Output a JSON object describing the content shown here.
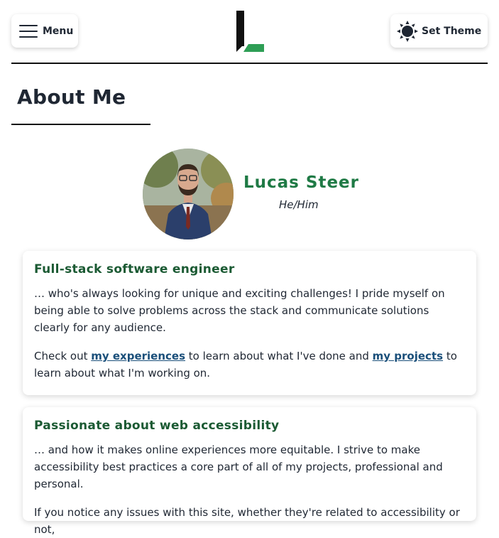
{
  "header": {
    "menu_label": "Menu",
    "theme_label": "Set Theme"
  },
  "page": {
    "title": "About Me"
  },
  "profile": {
    "name": "Lucas Steer",
    "pronouns": "He/Him"
  },
  "cards": [
    {
      "heading": "Full-stack software engineer",
      "paragraph1": "… who's always looking for unique and exciting challenges! I pride myself on being able to solve problems across the stack and communicate solutions clearly for any audience.",
      "p2_before": "Check out ",
      "p2_link1": "my experiences",
      "p2_mid": " to learn about what I've done and ",
      "p2_link2": "my projects",
      "p2_after": " to learn about what I'm working on."
    },
    {
      "heading": "Passionate about web accessibility",
      "paragraph1": "… and how it makes online experiences more equitable. I strive to make accessibility best practices a core part of all of my projects, professional and personal.",
      "paragraph2": "If you notice any issues with this site, whether they're related to accessibility or not,"
    }
  ],
  "colors": {
    "accent_green": "#1f7a45",
    "heading_green": "#1b5a33",
    "link_blue": "#1a4f7a",
    "text_dark": "#1f2733"
  },
  "icons": {
    "menu": "hamburger-icon",
    "theme": "sun-icon",
    "logo": "site-logo"
  }
}
